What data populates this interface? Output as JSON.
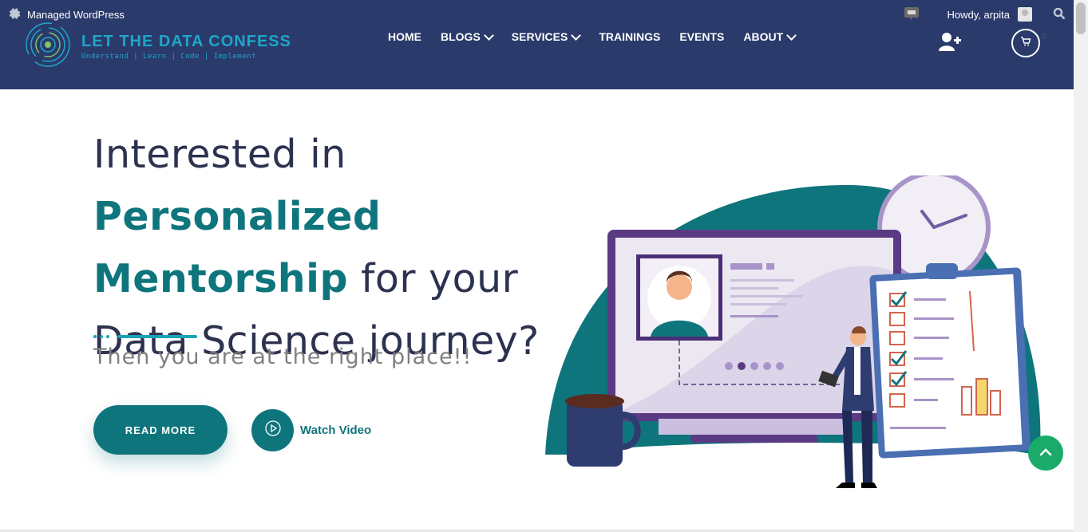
{
  "adminbar": {
    "site_label": "Managed WordPress",
    "greeting": "Howdy, arpita"
  },
  "logo": {
    "title": "LET THE DATA CONFESS",
    "tagline": "Understand | Learn | Code | Implement"
  },
  "nav": {
    "items": [
      {
        "label": "HOME"
      },
      {
        "label": "BLOGS"
      },
      {
        "label": "SERVICES"
      },
      {
        "label": "TRAININGS"
      },
      {
        "label": "EVENTS"
      },
      {
        "label": "ABOUT"
      }
    ]
  },
  "cart": {
    "count": "0"
  },
  "hero": {
    "title_part1": "Interested in ",
    "title_accent1": "Personalized Mentorship",
    "title_part2": " for your Data Science journey?",
    "subtitle": "Then you are at the right place!!",
    "read_more_label": "READ MORE",
    "watch_video_label": "Watch Video"
  },
  "colors": {
    "header_bg": "#2a3a6b",
    "accent": "#0f757c",
    "divider": "#19a3b5",
    "to_top": "#1aaa6a"
  },
  "icons": [
    "gear-icon",
    "comment-icon",
    "search-icon",
    "add-user-icon",
    "cart-icon",
    "play-icon",
    "arrow-up-icon",
    "chevron-down-icon"
  ]
}
